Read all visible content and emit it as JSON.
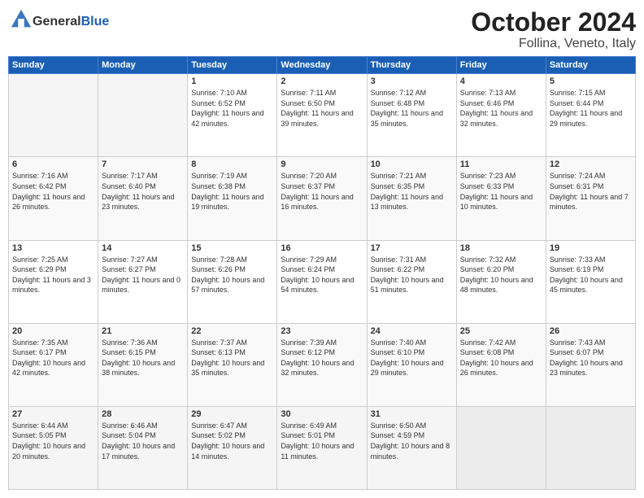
{
  "header": {
    "logo_general": "General",
    "logo_blue": "Blue",
    "month": "October 2024",
    "location": "Follina, Veneto, Italy"
  },
  "weekdays": [
    "Sunday",
    "Monday",
    "Tuesday",
    "Wednesday",
    "Thursday",
    "Friday",
    "Saturday"
  ],
  "weeks": [
    [
      {
        "day": "",
        "empty": true
      },
      {
        "day": "",
        "empty": true
      },
      {
        "day": "1",
        "sunrise": "Sunrise: 7:10 AM",
        "sunset": "Sunset: 6:52 PM",
        "daylight": "Daylight: 11 hours and 42 minutes."
      },
      {
        "day": "2",
        "sunrise": "Sunrise: 7:11 AM",
        "sunset": "Sunset: 6:50 PM",
        "daylight": "Daylight: 11 hours and 39 minutes."
      },
      {
        "day": "3",
        "sunrise": "Sunrise: 7:12 AM",
        "sunset": "Sunset: 6:48 PM",
        "daylight": "Daylight: 11 hours and 35 minutes."
      },
      {
        "day": "4",
        "sunrise": "Sunrise: 7:13 AM",
        "sunset": "Sunset: 6:46 PM",
        "daylight": "Daylight: 11 hours and 32 minutes."
      },
      {
        "day": "5",
        "sunrise": "Sunrise: 7:15 AM",
        "sunset": "Sunset: 6:44 PM",
        "daylight": "Daylight: 11 hours and 29 minutes."
      }
    ],
    [
      {
        "day": "6",
        "sunrise": "Sunrise: 7:16 AM",
        "sunset": "Sunset: 6:42 PM",
        "daylight": "Daylight: 11 hours and 26 minutes."
      },
      {
        "day": "7",
        "sunrise": "Sunrise: 7:17 AM",
        "sunset": "Sunset: 6:40 PM",
        "daylight": "Daylight: 11 hours and 23 minutes."
      },
      {
        "day": "8",
        "sunrise": "Sunrise: 7:19 AM",
        "sunset": "Sunset: 6:38 PM",
        "daylight": "Daylight: 11 hours and 19 minutes."
      },
      {
        "day": "9",
        "sunrise": "Sunrise: 7:20 AM",
        "sunset": "Sunset: 6:37 PM",
        "daylight": "Daylight: 11 hours and 16 minutes."
      },
      {
        "day": "10",
        "sunrise": "Sunrise: 7:21 AM",
        "sunset": "Sunset: 6:35 PM",
        "daylight": "Daylight: 11 hours and 13 minutes."
      },
      {
        "day": "11",
        "sunrise": "Sunrise: 7:23 AM",
        "sunset": "Sunset: 6:33 PM",
        "daylight": "Daylight: 11 hours and 10 minutes."
      },
      {
        "day": "12",
        "sunrise": "Sunrise: 7:24 AM",
        "sunset": "Sunset: 6:31 PM",
        "daylight": "Daylight: 11 hours and 7 minutes."
      }
    ],
    [
      {
        "day": "13",
        "sunrise": "Sunrise: 7:25 AM",
        "sunset": "Sunset: 6:29 PM",
        "daylight": "Daylight: 11 hours and 3 minutes."
      },
      {
        "day": "14",
        "sunrise": "Sunrise: 7:27 AM",
        "sunset": "Sunset: 6:27 PM",
        "daylight": "Daylight: 11 hours and 0 minutes."
      },
      {
        "day": "15",
        "sunrise": "Sunrise: 7:28 AM",
        "sunset": "Sunset: 6:26 PM",
        "daylight": "Daylight: 10 hours and 57 minutes."
      },
      {
        "day": "16",
        "sunrise": "Sunrise: 7:29 AM",
        "sunset": "Sunset: 6:24 PM",
        "daylight": "Daylight: 10 hours and 54 minutes."
      },
      {
        "day": "17",
        "sunrise": "Sunrise: 7:31 AM",
        "sunset": "Sunset: 6:22 PM",
        "daylight": "Daylight: 10 hours and 51 minutes."
      },
      {
        "day": "18",
        "sunrise": "Sunrise: 7:32 AM",
        "sunset": "Sunset: 6:20 PM",
        "daylight": "Daylight: 10 hours and 48 minutes."
      },
      {
        "day": "19",
        "sunrise": "Sunrise: 7:33 AM",
        "sunset": "Sunset: 6:19 PM",
        "daylight": "Daylight: 10 hours and 45 minutes."
      }
    ],
    [
      {
        "day": "20",
        "sunrise": "Sunrise: 7:35 AM",
        "sunset": "Sunset: 6:17 PM",
        "daylight": "Daylight: 10 hours and 42 minutes."
      },
      {
        "day": "21",
        "sunrise": "Sunrise: 7:36 AM",
        "sunset": "Sunset: 6:15 PM",
        "daylight": "Daylight: 10 hours and 38 minutes."
      },
      {
        "day": "22",
        "sunrise": "Sunrise: 7:37 AM",
        "sunset": "Sunset: 6:13 PM",
        "daylight": "Daylight: 10 hours and 35 minutes."
      },
      {
        "day": "23",
        "sunrise": "Sunrise: 7:39 AM",
        "sunset": "Sunset: 6:12 PM",
        "daylight": "Daylight: 10 hours and 32 minutes."
      },
      {
        "day": "24",
        "sunrise": "Sunrise: 7:40 AM",
        "sunset": "Sunset: 6:10 PM",
        "daylight": "Daylight: 10 hours and 29 minutes."
      },
      {
        "day": "25",
        "sunrise": "Sunrise: 7:42 AM",
        "sunset": "Sunset: 6:08 PM",
        "daylight": "Daylight: 10 hours and 26 minutes."
      },
      {
        "day": "26",
        "sunrise": "Sunrise: 7:43 AM",
        "sunset": "Sunset: 6:07 PM",
        "daylight": "Daylight: 10 hours and 23 minutes."
      }
    ],
    [
      {
        "day": "27",
        "sunrise": "Sunrise: 6:44 AM",
        "sunset": "Sunset: 5:05 PM",
        "daylight": "Daylight: 10 hours and 20 minutes."
      },
      {
        "day": "28",
        "sunrise": "Sunrise: 6:46 AM",
        "sunset": "Sunset: 5:04 PM",
        "daylight": "Daylight: 10 hours and 17 minutes."
      },
      {
        "day": "29",
        "sunrise": "Sunrise: 6:47 AM",
        "sunset": "Sunset: 5:02 PM",
        "daylight": "Daylight: 10 hours and 14 minutes."
      },
      {
        "day": "30",
        "sunrise": "Sunrise: 6:49 AM",
        "sunset": "Sunset: 5:01 PM",
        "daylight": "Daylight: 10 hours and 11 minutes."
      },
      {
        "day": "31",
        "sunrise": "Sunrise: 6:50 AM",
        "sunset": "Sunset: 4:59 PM",
        "daylight": "Daylight: 10 hours and 8 minutes."
      },
      {
        "day": "",
        "empty": true
      },
      {
        "day": "",
        "empty": true
      }
    ]
  ]
}
